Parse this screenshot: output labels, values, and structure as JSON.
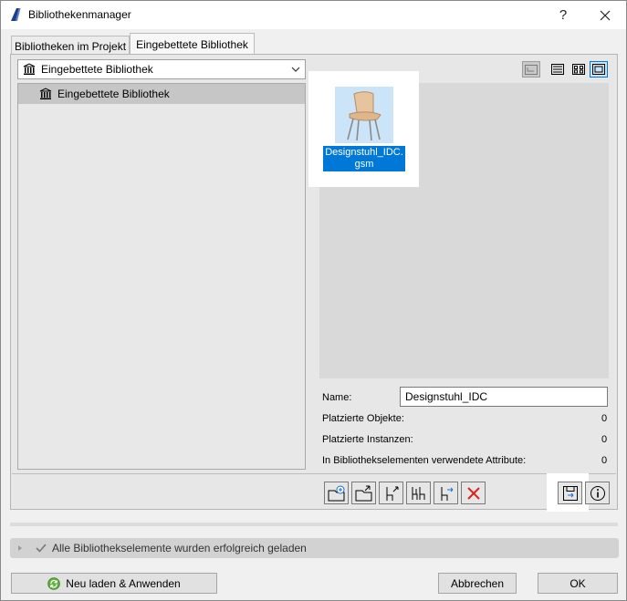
{
  "window": {
    "title": "Bibliothekenmanager",
    "help_symbol": "?",
    "close_symbol": "✕"
  },
  "tabs": [
    {
      "label": "Bibliotheken im Projekt"
    },
    {
      "label": "Eingebettete Bibliothek"
    }
  ],
  "library_dropdown": {
    "value": "Eingebettete Bibliothek"
  },
  "tree": {
    "items": [
      {
        "label": "Eingebettete Bibliothek"
      }
    ]
  },
  "preview": {
    "item": {
      "name_line1": "Designstuhl_IDC.",
      "name_line2": "gsm"
    }
  },
  "details": {
    "name_label": "Name:",
    "name_value": "Designstuhl_IDC",
    "placed_objects_label": "Platzierte Objekte:",
    "placed_objects_value": "0",
    "placed_instances_label": "Platzierte Instanzen:",
    "placed_instances_value": "0",
    "attributes_label": "In Bibliothekselementen verwendete Attribute:",
    "attributes_value": "0"
  },
  "status_bar": {
    "message": "Alle Bibliothekselemente wurden erfolgreich geladen"
  },
  "buttons": {
    "reload": "Neu laden & Anwenden",
    "cancel": "Abbrechen",
    "ok": "OK"
  },
  "colors": {
    "selection": "#0078d7",
    "highlight": "#cce4f7"
  }
}
